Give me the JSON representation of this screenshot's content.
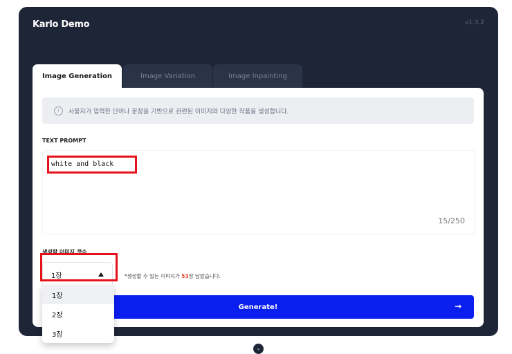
{
  "app": {
    "title": "Karlo Demo",
    "version": "v1.3.2"
  },
  "tabs": [
    {
      "label": "Image Generation",
      "active": true
    },
    {
      "label": "Image Variation",
      "active": false
    },
    {
      "label": "Image Inpainting",
      "active": false
    }
  ],
  "info": {
    "icon": "info-icon",
    "text": "사용자가 입력한 단어나 문장을 기반으로 관련된 이미지와 다양한 작품을 생성합니다."
  },
  "prompt": {
    "label": "TEXT PROMPT",
    "value": "white and black",
    "char_count": "15/250"
  },
  "count": {
    "label": "생성할 이미지 갯수",
    "selected": "1장",
    "note_prefix": "*생성할 수 있는 이미지가 ",
    "remaining": "53",
    "note_suffix": "장 남았습니다.",
    "options": [
      "1장",
      "2장",
      "3장"
    ]
  },
  "generate": {
    "label": "Generate!",
    "icon": "arrow-right-icon"
  },
  "colors": {
    "frame": "#1e2536",
    "accent_button": "#0a1ef0",
    "highlight": "#e5101a",
    "remaining": "#f04d3b"
  }
}
